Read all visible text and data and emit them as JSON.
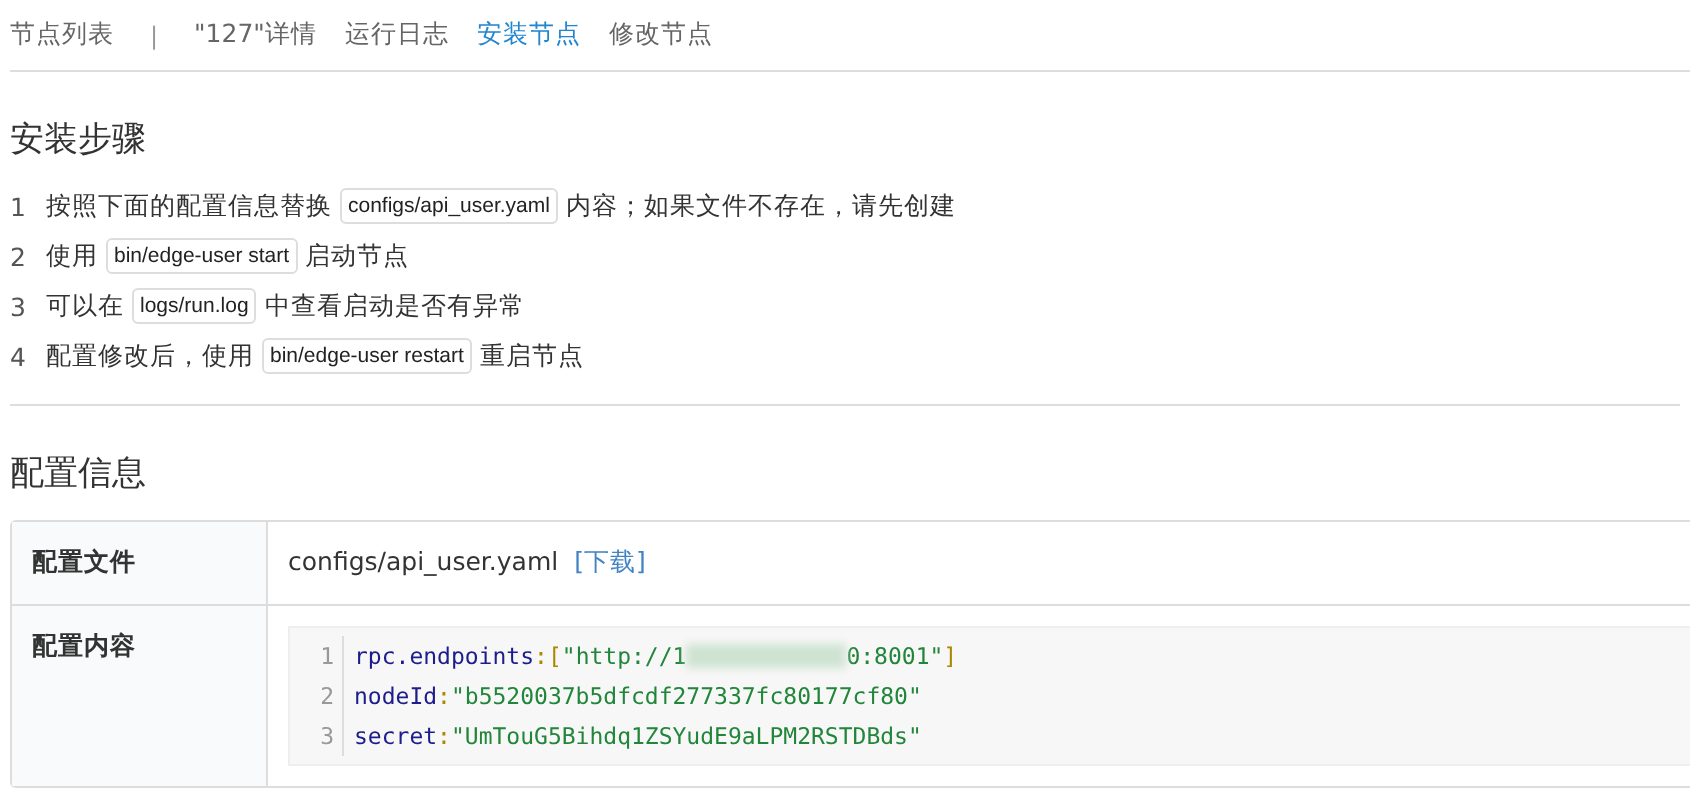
{
  "back_link": "节点列表",
  "separator": "|",
  "tabs": [
    {
      "label": "\"127\"详情",
      "selected": false
    },
    {
      "label": "运行日志",
      "selected": false
    },
    {
      "label": "安装节点",
      "selected": true
    },
    {
      "label": "修改节点",
      "selected": false
    }
  ],
  "install": {
    "title": "安装步骤",
    "steps": [
      {
        "number": "1",
        "parts": [
          {
            "kind": "text",
            "text": "按照下面的配置信息替换"
          },
          {
            "kind": "code",
            "text": "configs/api_user.yaml"
          },
          {
            "kind": "text",
            "text": "内容；如果文件不存在，请先创建"
          }
        ]
      },
      {
        "number": "2",
        "parts": [
          {
            "kind": "text",
            "text": "使用"
          },
          {
            "kind": "code",
            "text": "bin/edge-user start"
          },
          {
            "kind": "text",
            "text": "启动节点"
          }
        ]
      },
      {
        "number": "3",
        "parts": [
          {
            "kind": "text",
            "text": "可以在"
          },
          {
            "kind": "code",
            "text": "logs/run.log"
          },
          {
            "kind": "text",
            "text": "中查看启动是否有异常"
          }
        ]
      },
      {
        "number": "4",
        "parts": [
          {
            "kind": "text",
            "text": "配置修改后，使用"
          },
          {
            "kind": "code",
            "text": "bin/edge-user restart"
          },
          {
            "kind": "text",
            "text": "重启节点"
          }
        ]
      }
    ]
  },
  "config": {
    "title": "配置信息",
    "rows": [
      {
        "kind": "file",
        "label": "配置文件",
        "value": "configs/api_user.yaml",
        "link": "[下载]"
      },
      {
        "kind": "code",
        "label": "配置内容",
        "lines": [
          {
            "number": "1",
            "key": "rpc.endpoints",
            "colon": ":",
            "tokens": [
              {
                "kind": "punct",
                "text": "["
              },
              {
                "kind": "string",
                "text": "\"http://1"
              },
              {
                "kind": "redacted"
              },
              {
                "kind": "string",
                "text": "0:8001\""
              },
              {
                "kind": "punct",
                "text": "]"
              }
            ]
          },
          {
            "number": "2",
            "key": "nodeId",
            "colon": ":",
            "tokens": [
              {
                "kind": "string",
                "text": "\"b5520037b5dfcdf277337fc80177cf80\""
              }
            ]
          },
          {
            "number": "3",
            "key": "secret",
            "colon": ":",
            "tokens": [
              {
                "kind": "string",
                "text": "\"UmTouG5Bihdq1ZSYudE9aLPM2RSTDBds\""
              }
            ]
          }
        ]
      }
    ]
  }
}
